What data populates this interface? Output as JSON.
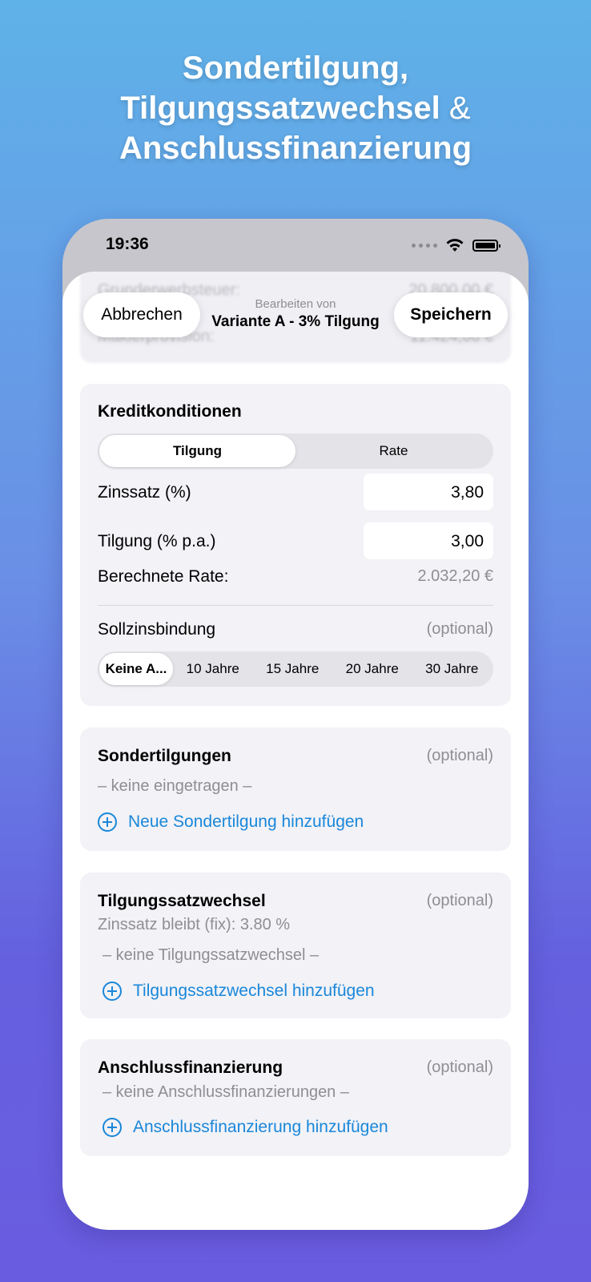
{
  "hero": {
    "line1": "Sondertilgung,",
    "line2": "Tilgungssatzwechsel",
    "amp": "&",
    "line3": "Anschlussfinanzierung"
  },
  "statusbar": {
    "time": "19:36"
  },
  "background_blur": {
    "row1_label": "Grunderwerbsteuer:",
    "row1_value": "20.800,00 €",
    "row2_label": "Maklerprovision:",
    "row2_value": "11.424,00 €"
  },
  "nav": {
    "cancel": "Abbrechen",
    "subtitle": "Bearbeiten von",
    "title": "Variante A - 3% Tilgung",
    "save": "Speichern"
  },
  "kredit": {
    "title": "Kreditkonditionen",
    "mode_options": [
      "Tilgung",
      "Rate"
    ],
    "mode_selected": "Tilgung",
    "zins_label": "Zinssatz (%)",
    "zins_value": "3,80",
    "tilgung_label": "Tilgung (% p.a.)",
    "tilgung_value": "3,00",
    "rate_label": "Berechnete Rate:",
    "rate_value": "2.032,20 €",
    "bindung_label": "Sollzinsbindung",
    "bindung_optional": "(optional)",
    "bindung_options": [
      "Keine A...",
      "10 Jahre",
      "15 Jahre",
      "20 Jahre",
      "30 Jahre"
    ],
    "bindung_selected": "Keine A..."
  },
  "sonder": {
    "title": "Sondertilgungen",
    "optional": "(optional)",
    "empty": "– keine eingetragen –",
    "add": "Neue Sondertilgung hinzufügen"
  },
  "wechsel": {
    "title": "Tilgungssatzwechsel",
    "optional": "(optional)",
    "info": "Zinssatz bleibt (fix): 3.80 %",
    "empty": "– keine Tilgungssatzwechsel –",
    "add": "Tilgungssatzwechsel hinzufügen"
  },
  "anschluss": {
    "title": "Anschlussfinanzierung",
    "optional": "(optional)",
    "empty": "– keine Anschlussfinanzierungen –",
    "add": "Anschlussfinanzierung hinzufügen"
  },
  "colors": {
    "accent": "#1a87d9",
    "card_bg": "#f2f2f7",
    "secondary_text": "#8e8e93"
  }
}
